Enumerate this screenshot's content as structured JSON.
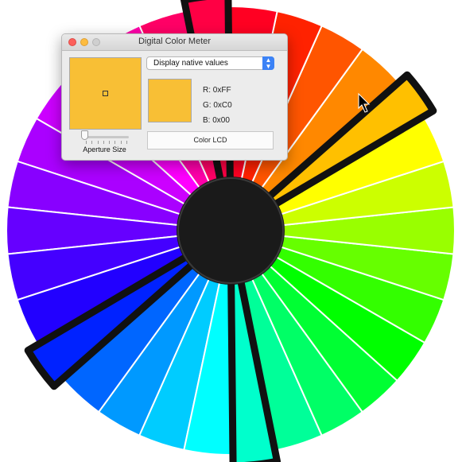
{
  "wheel": {
    "segments": [
      {
        "color": "#ff0022",
        "highlighted": false
      },
      {
        "color": "#ff2200",
        "highlighted": false
      },
      {
        "color": "#ff5500",
        "highlighted": false
      },
      {
        "color": "#ff8800",
        "highlighted": false
      },
      {
        "color": "#ffc000",
        "highlighted": true
      },
      {
        "color": "#ffff00",
        "highlighted": false
      },
      {
        "color": "#ccff00",
        "highlighted": false
      },
      {
        "color": "#99ff00",
        "highlighted": false
      },
      {
        "color": "#66ff00",
        "highlighted": false
      },
      {
        "color": "#33ff00",
        "highlighted": false
      },
      {
        "color": "#00ff00",
        "highlighted": false
      },
      {
        "color": "#00ff33",
        "highlighted": false
      },
      {
        "color": "#00ff66",
        "highlighted": false
      },
      {
        "color": "#00ff99",
        "highlighted": false
      },
      {
        "color": "#00ffcc",
        "highlighted": true
      },
      {
        "color": "#00ffff",
        "highlighted": false
      },
      {
        "color": "#00ccff",
        "highlighted": false
      },
      {
        "color": "#0099ff",
        "highlighted": false
      },
      {
        "color": "#0066ff",
        "highlighted": false
      },
      {
        "color": "#0022ff",
        "highlighted": true
      },
      {
        "color": "#2200ff",
        "highlighted": false
      },
      {
        "color": "#4400ff",
        "highlighted": false
      },
      {
        "color": "#6600ff",
        "highlighted": false
      },
      {
        "color": "#8800ff",
        "highlighted": false
      },
      {
        "color": "#aa00ff",
        "highlighted": false
      },
      {
        "color": "#cc00ff",
        "highlighted": false
      },
      {
        "color": "#ff00ff",
        "highlighted": false
      },
      {
        "color": "#ff00aa",
        "highlighted": false
      },
      {
        "color": "#ff0066",
        "highlighted": false
      },
      {
        "color": "#ff0044",
        "highlighted": true
      }
    ],
    "hub_color": "#1a1a1a",
    "cursor_icon": "arrow-cursor-icon"
  },
  "meter": {
    "title": "Digital Color Meter",
    "sampled_color": "#f8bf35",
    "aperture_label": "Aperture Size",
    "aperture_level": 0.0,
    "display_mode": "Display native values",
    "r_label": "R: 0xFF",
    "g_label": "G: 0xC0",
    "b_label": "B: 0x00",
    "profile": "Color LCD"
  }
}
